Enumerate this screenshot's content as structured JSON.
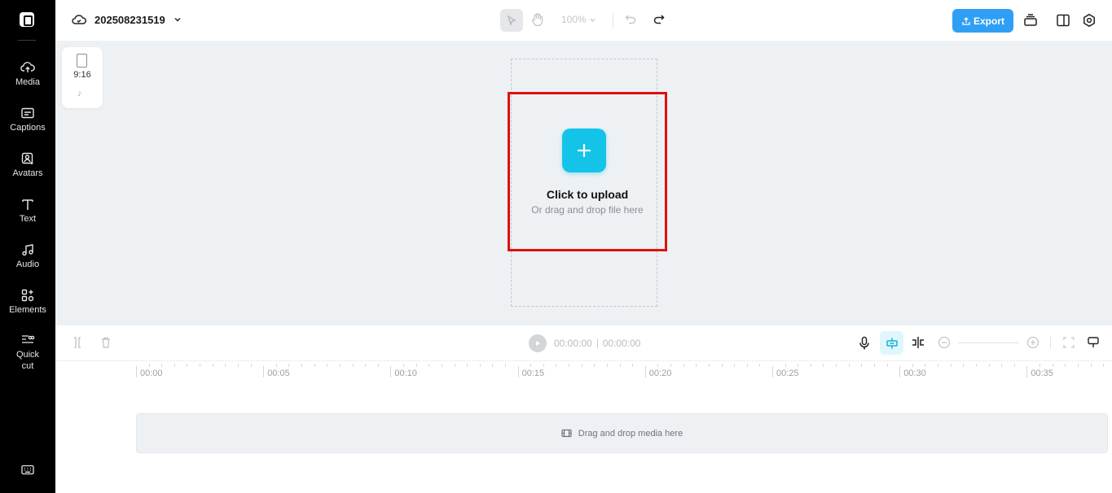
{
  "sidebar": {
    "items": [
      {
        "label": "Media",
        "icon": "cloud-upload-icon"
      },
      {
        "label": "Captions",
        "icon": "captions-icon"
      },
      {
        "label": "Avatars",
        "icon": "avatar-icon"
      },
      {
        "label": "Text",
        "icon": "text-icon"
      },
      {
        "label": "Audio",
        "icon": "music-note-icon"
      },
      {
        "label": "Elements",
        "icon": "elements-icon"
      },
      {
        "label": "Quick\ncut",
        "icon": "quick-cut-icon"
      }
    ]
  },
  "topbar": {
    "project_name": "202508231519",
    "zoom": "100%",
    "export_label": "Export"
  },
  "canvas": {
    "ratio_label": "9:16",
    "upload_title": "Click to upload",
    "upload_subtitle": "Or drag and drop file here"
  },
  "timeline": {
    "current_time": "00:00:00",
    "total_time": "00:00:00",
    "ruler_labels": [
      "00:00",
      "00:05",
      "00:10",
      "00:15",
      "00:20",
      "00:25",
      "00:30",
      "00:35"
    ],
    "drop_text": "Drag and drop media here"
  },
  "colors": {
    "accent": "#14c3e8",
    "export_button": "#2f9ff5",
    "highlight_border": "#e01010",
    "sidebar_bg": "#000000",
    "canvas_bg": "#eef1f4"
  }
}
